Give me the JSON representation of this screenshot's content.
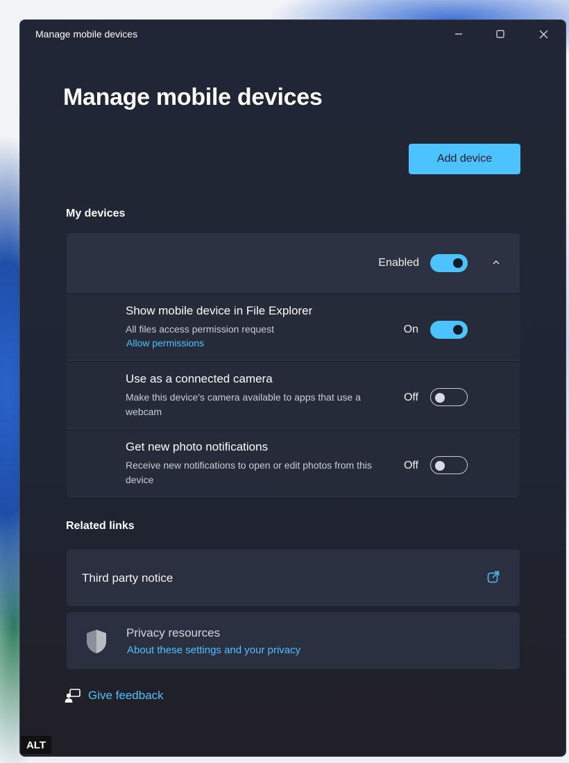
{
  "window": {
    "title": "Manage mobile devices",
    "controls": [
      "minimize-icon",
      "maximize-icon",
      "close-icon"
    ]
  },
  "page": {
    "heading": "Manage mobile devices",
    "add_device_label": "Add device"
  },
  "my_devices": {
    "heading": "My devices",
    "device_status_label": "Enabled",
    "device_enabled": true,
    "settings": [
      {
        "title": "Show mobile device in File Explorer",
        "description": "All files access permission request",
        "link": "Allow permissions",
        "state_label": "On",
        "on": true
      },
      {
        "title": "Use as a connected camera",
        "description": "Make this device's camera available to apps that use a webcam",
        "state_label": "Off",
        "on": false
      },
      {
        "title": "Get new photo notifications",
        "description": "Receive new notifications to open or edit photos from this device",
        "state_label": "Off",
        "on": false
      }
    ]
  },
  "related_links": {
    "heading": "Related links",
    "third_party_notice": "Third party notice",
    "privacy_title": "Privacy resources",
    "privacy_link": "About these settings and your privacy"
  },
  "feedback": {
    "label": "Give feedback"
  },
  "alt_badge": "ALT",
  "colors": {
    "accent": "#4cc2ff",
    "window_bg": "#202635",
    "card_bg": "#2b3040"
  }
}
